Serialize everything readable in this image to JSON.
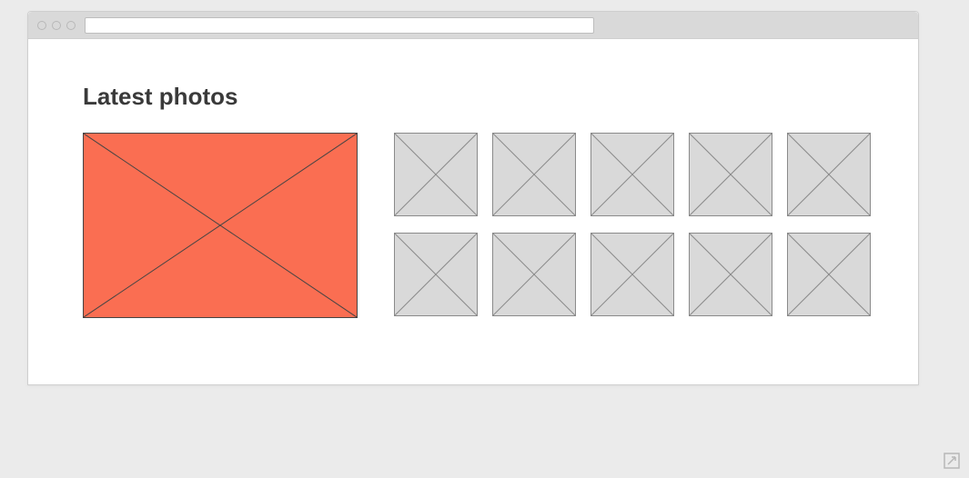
{
  "page": {
    "title": "Latest photos"
  },
  "gallery": {
    "featured_color": "#fa6e52",
    "thumbnail_count": 10
  },
  "icons": {
    "resize": "resize-handle-icon"
  }
}
